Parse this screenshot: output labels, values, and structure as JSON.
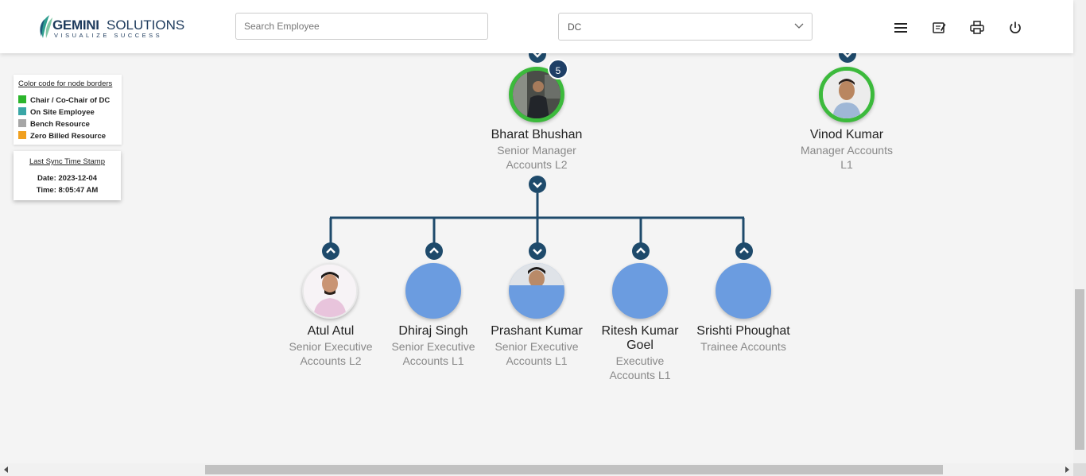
{
  "header": {
    "logo_name_bold": "GEMINI",
    "logo_name_light": "SOLUTIONS",
    "logo_tagline": "VISUALIZE SUCCESS",
    "search_placeholder": "Search Employee",
    "dc_value": "DC",
    "icons": [
      "menu-icon",
      "notes-icon",
      "print-icon",
      "power-icon"
    ]
  },
  "legend": {
    "title": "Color code for node borders",
    "items": [
      {
        "label": "Chair / Co-Chair of DC",
        "color": "#2cb52c"
      },
      {
        "label": "On Site Employee",
        "color": "#3aa6a6"
      },
      {
        "label": "Bench Resource",
        "color": "#a6a6a6"
      },
      {
        "label": "Zero Billed Resource",
        "color": "#f0a020"
      }
    ]
  },
  "sync": {
    "title": "Last Sync Time Stamp",
    "date_line": "Date: 2023-12-04",
    "time_line": "Time: 8:05:47 AM"
  },
  "colors": {
    "connector": "#1e4a6b",
    "chair_border": "#3cba3c",
    "placeholder_avatar": "#6b9ce0",
    "badge": "#1e3f66"
  },
  "org": {
    "managers": [
      {
        "name": "Bharat Bhushan",
        "title_line1": "Senior Manager",
        "title_line2": "Accounts L2",
        "badge": "5",
        "border": "chair"
      },
      {
        "name": "Vinod Kumar",
        "title_line1": "Manager Accounts",
        "title_line2": "L1",
        "border": "chair"
      }
    ],
    "reports": [
      {
        "name": "Atul Atul",
        "title_line1": "Senior Executive",
        "title_line2": "Accounts L2"
      },
      {
        "name": "Dhiraj Singh",
        "title_line1": "Senior Executive",
        "title_line2": "Accounts L1"
      },
      {
        "name": "Prashant Kumar",
        "title_line1": "Senior Executive",
        "title_line2": "Accounts L1"
      },
      {
        "name_line1": "Ritesh Kumar",
        "name_line2": "Goel",
        "title_line1": "Executive",
        "title_line2": "Accounts L1"
      },
      {
        "name": "Srishti Phoughat",
        "title_line1": "Trainee Accounts"
      }
    ]
  }
}
